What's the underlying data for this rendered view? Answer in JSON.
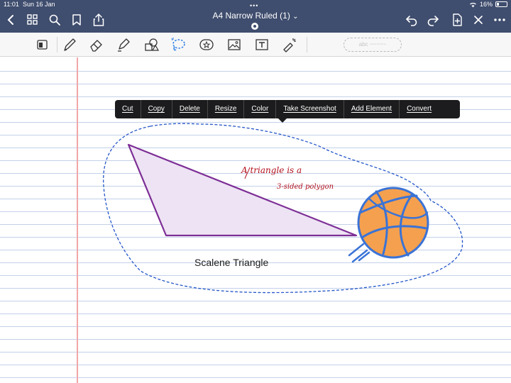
{
  "status_bar": {
    "time": "11:01",
    "date": "Sun 16 Jan",
    "battery": "16%"
  },
  "header": {
    "title": "A4 Narrow Ruled (1)",
    "title_chevron": "⌄",
    "more": "•••"
  },
  "colors": {
    "header_bg": "#3f4d6e",
    "margin_line": "#f2a6a8",
    "rule_line": "#c3d1e9",
    "selection": "#2456c9",
    "triangle_stroke": "#7d2e96",
    "triangle_fill": "#eee3f4",
    "handwriting": "#b3101c",
    "ball": "#f5a04e",
    "ball_seams": "#3a73d6"
  },
  "nav_icons": [
    "back-icon",
    "grid-icon",
    "search-icon",
    "bookmark-icon",
    "share-icon",
    "undo-icon",
    "redo-icon",
    "add-page-icon",
    "close-icon",
    "more-icon"
  ],
  "tools": [
    "reader-icon",
    "pen-icon",
    "eraser-icon",
    "highlighter-icon",
    "shapes-icon",
    "lasso-icon",
    "sticker-icon",
    "image-icon",
    "text-icon",
    "laser-pointer-icon"
  ],
  "shape_pill_text": "abc ~~~~~",
  "context_menu": {
    "items": [
      "Cut",
      "Copy",
      "Delete",
      "Resize",
      "Color",
      "Take Screenshot",
      "Add Element",
      "Convert"
    ]
  },
  "canvas": {
    "caption": "Scalene Triangle",
    "note_line1": "A triangle is a",
    "note_line2": "3-sided polygon"
  }
}
